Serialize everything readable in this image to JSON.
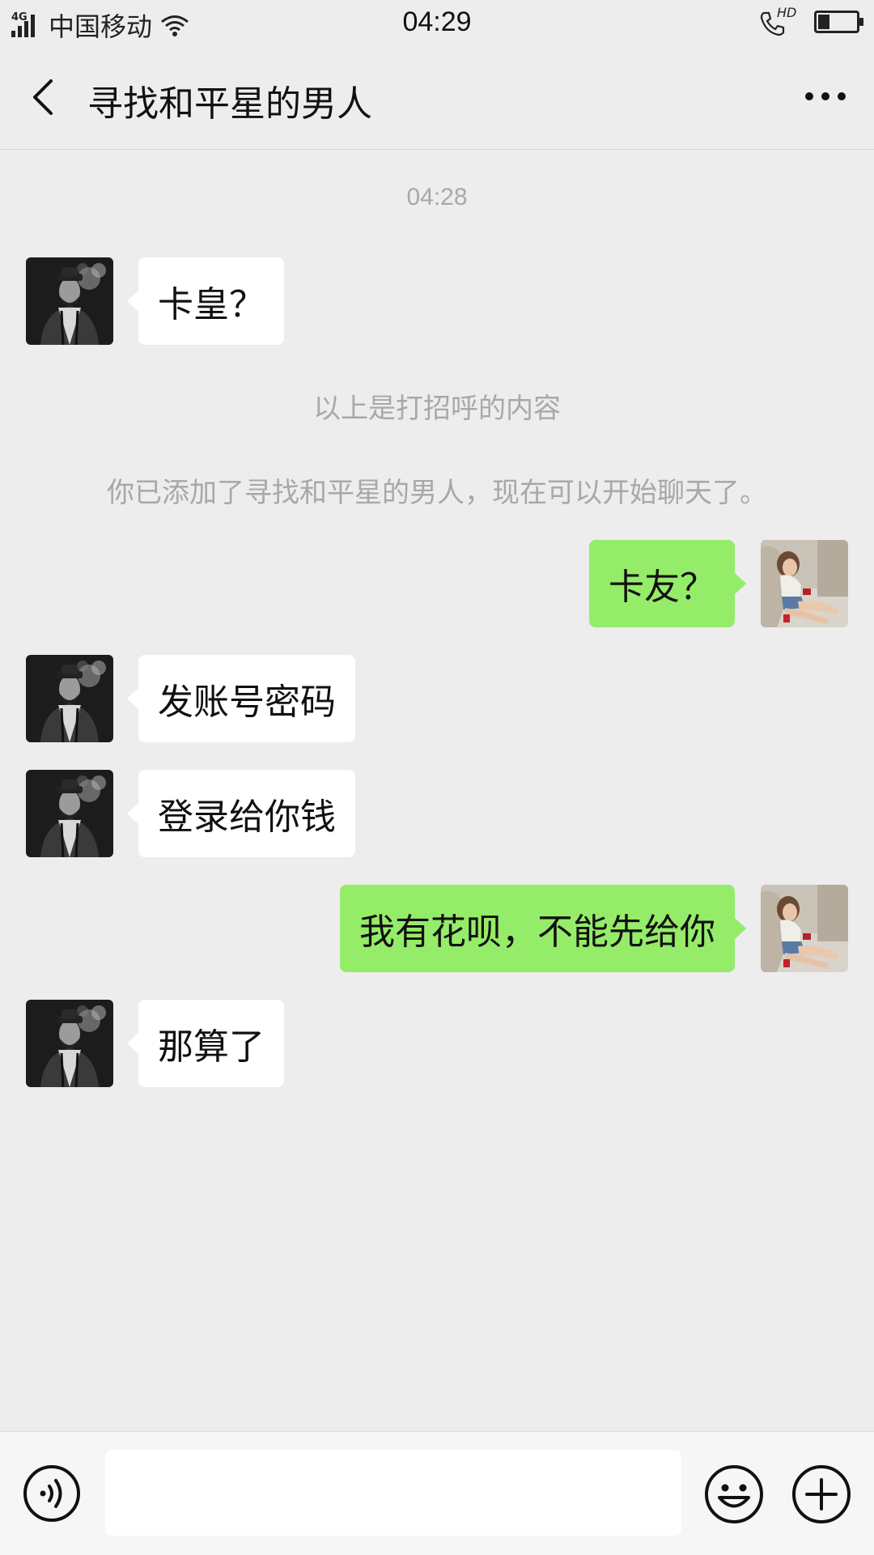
{
  "status_bar": {
    "network_type": "4G",
    "carrier": "中国移动",
    "time": "04:29",
    "call_quality": "HD",
    "battery_level": 0.3
  },
  "header": {
    "title": "寻找和平星的男人",
    "back_icon": "chevron-left-icon",
    "more_icon": "more-dots-icon"
  },
  "chat": {
    "timestamp": "04:28",
    "messages": [
      {
        "side": "left",
        "text": "卡皇？"
      },
      {
        "side": "system",
        "text": "以上是打招呼的内容"
      },
      {
        "side": "system",
        "text": "你已添加了寻找和平星的男人，现在可以开始聊天了。"
      },
      {
        "side": "right",
        "text": "卡友？"
      },
      {
        "side": "left",
        "text": "发账号密码"
      },
      {
        "side": "left",
        "text": "登录给你钱"
      },
      {
        "side": "right",
        "text": "我有花呗，不能先给你"
      },
      {
        "side": "left",
        "text": "那算了"
      }
    ]
  },
  "input_bar": {
    "voice_icon": "voice-icon",
    "input_value": "",
    "emoji_icon": "emoji-icon",
    "plus_icon": "plus-circle-icon"
  },
  "colors": {
    "background": "#ededed",
    "outgoing_bubble": "#95ec69",
    "incoming_bubble": "#ffffff",
    "system_text": "#a8a8a8"
  }
}
